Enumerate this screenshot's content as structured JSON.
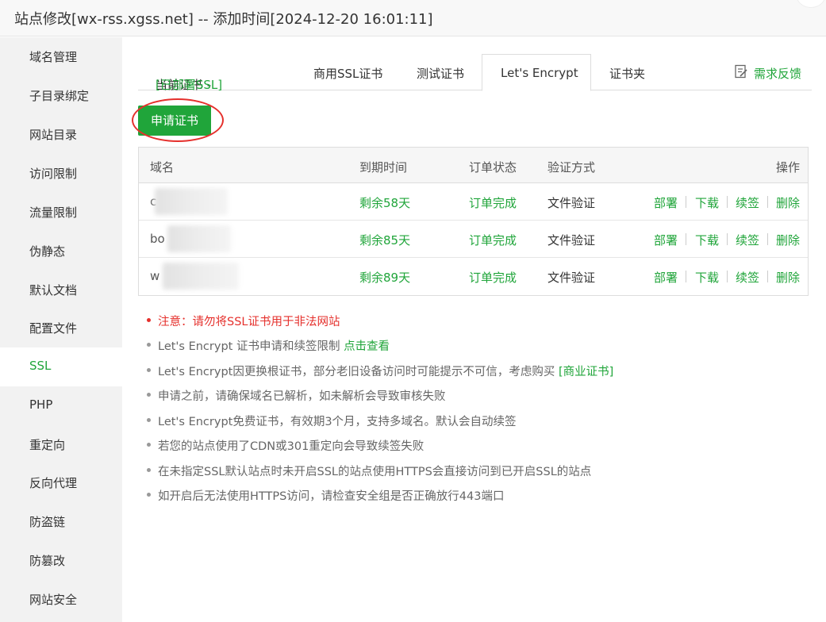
{
  "window": {
    "title": "站点修改[wx-rss.xgss.net] -- 添加时间[2024-12-20 16:01:11]"
  },
  "sidebar": {
    "items": [
      {
        "label": "域名管理"
      },
      {
        "label": "子目录绑定"
      },
      {
        "label": "网站目录"
      },
      {
        "label": "访问限制"
      },
      {
        "label": "流量限制"
      },
      {
        "label": "伪静态"
      },
      {
        "label": "默认文档"
      },
      {
        "label": "配置文件"
      },
      {
        "label": "SSL",
        "active": true
      },
      {
        "label": "PHP"
      },
      {
        "label": "重定向"
      },
      {
        "label": "反向代理"
      },
      {
        "label": "防盗链"
      },
      {
        "label": "防篡改"
      },
      {
        "label": "网站安全"
      }
    ]
  },
  "tabs": {
    "current_prefix": "当前证书 - ",
    "current_status": "[已部署SSL]",
    "commercial": "商用SSL证书",
    "test": "测试证书",
    "letsencrypt": "Let's Encrypt",
    "folder": "证书夹",
    "feedback": "需求反馈"
  },
  "apply_button": "申请证书",
  "table": {
    "headers": {
      "domain": "域名",
      "expire": "到期时间",
      "status": "订单状态",
      "verify": "验证方式",
      "actions": "操作"
    },
    "rows": [
      {
        "domain": "c",
        "expire": "剩余58天",
        "status": "订单完成",
        "verify": "文件验证"
      },
      {
        "domain": "bo",
        "expire": "剩余85天",
        "status": "订单完成",
        "verify": "文件验证"
      },
      {
        "domain": "w",
        "expire": "剩余89天",
        "status": "订单完成",
        "verify": "文件验证"
      }
    ],
    "actions": {
      "deploy": "部署",
      "download": "下载",
      "renew": "续签",
      "delete": "删除"
    }
  },
  "notes": {
    "warning": "注意：请勿将SSL证书用于非法网站",
    "limit_text": "Let's Encrypt 证书申请和续签限制 ",
    "limit_link": "点击查看",
    "root_text": "Let's Encrypt因更换根证书，部分老旧设备访问时可能提示不可信，考虑购买 ",
    "root_link": "[商业证书]",
    "resolve": "申请之前，请确保域名已解析，如未解析会导致审核失败",
    "free": "Let's Encrypt免费证书，有效期3个月，支持多域名。默认会自动续签",
    "cdn": "若您的站点使用了CDN或301重定向会导致续签失败",
    "default_site": "在未指定SSL默认站点时未开启SSL的站点使用HTTPS会直接访问到已开启SSL的站点",
    "port": "如开启后无法使用HTTPS访问，请检查安全组是否正确放行443端口"
  },
  "colors": {
    "accent": "#20a53a",
    "warning": "#e5302c"
  }
}
